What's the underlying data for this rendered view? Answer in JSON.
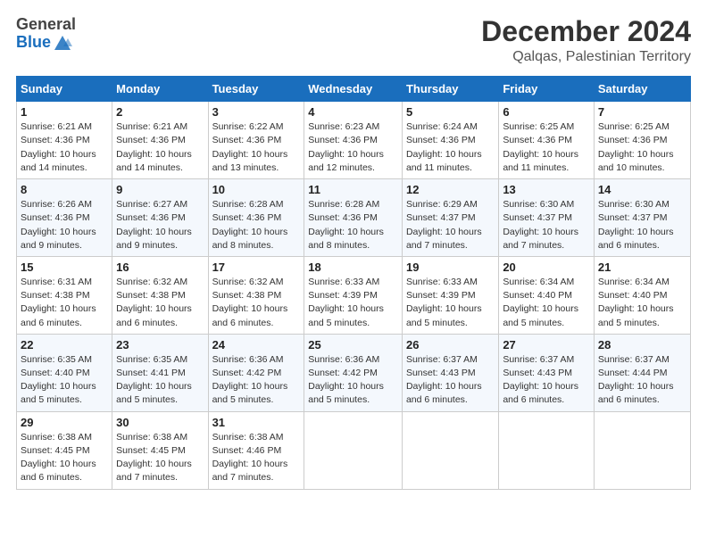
{
  "logo": {
    "general": "General",
    "blue": "Blue"
  },
  "title": "December 2024",
  "subtitle": "Qalqas, Palestinian Territory",
  "days_of_week": [
    "Sunday",
    "Monday",
    "Tuesday",
    "Wednesday",
    "Thursday",
    "Friday",
    "Saturday"
  ],
  "weeks": [
    [
      {
        "day": "1",
        "sunrise": "6:21 AM",
        "sunset": "4:36 PM",
        "daylight": "10 hours and 14 minutes."
      },
      {
        "day": "2",
        "sunrise": "6:21 AM",
        "sunset": "4:36 PM",
        "daylight": "10 hours and 14 minutes."
      },
      {
        "day": "3",
        "sunrise": "6:22 AM",
        "sunset": "4:36 PM",
        "daylight": "10 hours and 13 minutes."
      },
      {
        "day": "4",
        "sunrise": "6:23 AM",
        "sunset": "4:36 PM",
        "daylight": "10 hours and 12 minutes."
      },
      {
        "day": "5",
        "sunrise": "6:24 AM",
        "sunset": "4:36 PM",
        "daylight": "10 hours and 11 minutes."
      },
      {
        "day": "6",
        "sunrise": "6:25 AM",
        "sunset": "4:36 PM",
        "daylight": "10 hours and 11 minutes."
      },
      {
        "day": "7",
        "sunrise": "6:25 AM",
        "sunset": "4:36 PM",
        "daylight": "10 hours and 10 minutes."
      }
    ],
    [
      {
        "day": "8",
        "sunrise": "6:26 AM",
        "sunset": "4:36 PM",
        "daylight": "10 hours and 9 minutes."
      },
      {
        "day": "9",
        "sunrise": "6:27 AM",
        "sunset": "4:36 PM",
        "daylight": "10 hours and 9 minutes."
      },
      {
        "day": "10",
        "sunrise": "6:28 AM",
        "sunset": "4:36 PM",
        "daylight": "10 hours and 8 minutes."
      },
      {
        "day": "11",
        "sunrise": "6:28 AM",
        "sunset": "4:36 PM",
        "daylight": "10 hours and 8 minutes."
      },
      {
        "day": "12",
        "sunrise": "6:29 AM",
        "sunset": "4:37 PM",
        "daylight": "10 hours and 7 minutes."
      },
      {
        "day": "13",
        "sunrise": "6:30 AM",
        "sunset": "4:37 PM",
        "daylight": "10 hours and 7 minutes."
      },
      {
        "day": "14",
        "sunrise": "6:30 AM",
        "sunset": "4:37 PM",
        "daylight": "10 hours and 6 minutes."
      }
    ],
    [
      {
        "day": "15",
        "sunrise": "6:31 AM",
        "sunset": "4:38 PM",
        "daylight": "10 hours and 6 minutes."
      },
      {
        "day": "16",
        "sunrise": "6:32 AM",
        "sunset": "4:38 PM",
        "daylight": "10 hours and 6 minutes."
      },
      {
        "day": "17",
        "sunrise": "6:32 AM",
        "sunset": "4:38 PM",
        "daylight": "10 hours and 6 minutes."
      },
      {
        "day": "18",
        "sunrise": "6:33 AM",
        "sunset": "4:39 PM",
        "daylight": "10 hours and 5 minutes."
      },
      {
        "day": "19",
        "sunrise": "6:33 AM",
        "sunset": "4:39 PM",
        "daylight": "10 hours and 5 minutes."
      },
      {
        "day": "20",
        "sunrise": "6:34 AM",
        "sunset": "4:40 PM",
        "daylight": "10 hours and 5 minutes."
      },
      {
        "day": "21",
        "sunrise": "6:34 AM",
        "sunset": "4:40 PM",
        "daylight": "10 hours and 5 minutes."
      }
    ],
    [
      {
        "day": "22",
        "sunrise": "6:35 AM",
        "sunset": "4:40 PM",
        "daylight": "10 hours and 5 minutes."
      },
      {
        "day": "23",
        "sunrise": "6:35 AM",
        "sunset": "4:41 PM",
        "daylight": "10 hours and 5 minutes."
      },
      {
        "day": "24",
        "sunrise": "6:36 AM",
        "sunset": "4:42 PM",
        "daylight": "10 hours and 5 minutes."
      },
      {
        "day": "25",
        "sunrise": "6:36 AM",
        "sunset": "4:42 PM",
        "daylight": "10 hours and 5 minutes."
      },
      {
        "day": "26",
        "sunrise": "6:37 AM",
        "sunset": "4:43 PM",
        "daylight": "10 hours and 6 minutes."
      },
      {
        "day": "27",
        "sunrise": "6:37 AM",
        "sunset": "4:43 PM",
        "daylight": "10 hours and 6 minutes."
      },
      {
        "day": "28",
        "sunrise": "6:37 AM",
        "sunset": "4:44 PM",
        "daylight": "10 hours and 6 minutes."
      }
    ],
    [
      {
        "day": "29",
        "sunrise": "6:38 AM",
        "sunset": "4:45 PM",
        "daylight": "10 hours and 6 minutes."
      },
      {
        "day": "30",
        "sunrise": "6:38 AM",
        "sunset": "4:45 PM",
        "daylight": "10 hours and 7 minutes."
      },
      {
        "day": "31",
        "sunrise": "6:38 AM",
        "sunset": "4:46 PM",
        "daylight": "10 hours and 7 minutes."
      },
      null,
      null,
      null,
      null
    ]
  ],
  "labels": {
    "sunrise": "Sunrise:",
    "sunset": "Sunset:",
    "daylight": "Daylight:"
  }
}
